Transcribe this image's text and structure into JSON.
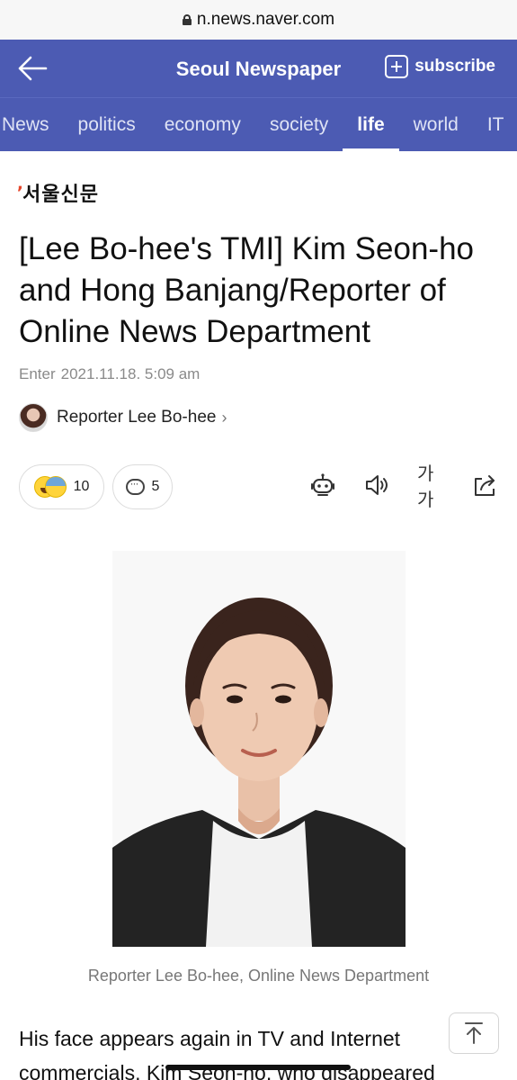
{
  "browser": {
    "url": "n.news.naver.com"
  },
  "header": {
    "title": "Seoul Newspaper",
    "subscribe_label": "subscribe"
  },
  "tabs": [
    {
      "label": "News",
      "active": false
    },
    {
      "label": "politics",
      "active": false
    },
    {
      "label": "economy",
      "active": false
    },
    {
      "label": "society",
      "active": false
    },
    {
      "label": "life",
      "active": true
    },
    {
      "label": "world",
      "active": false
    },
    {
      "label": "IT",
      "active": false
    }
  ],
  "article": {
    "publisher_logo": "서울신문",
    "headline": "[Lee Bo-hee's TMI] Kim Seon-ho and Hong Banjang/Reporter of Online News Department",
    "date_label": "Enter",
    "date_value": "2021.11.18. 5:09 am",
    "reporter": "Reporter Lee Bo-hee",
    "reaction_count": "10",
    "comment_count": "5",
    "font_size_label": "가가",
    "photo_caption": "Reporter Lee Bo-hee, Online News Department",
    "body_prefix": "His face appears again in TV and Internet commercials. ",
    "body_underlined": "Kim Seon-ho, who disappeared"
  },
  "colors": {
    "header_bg": "#4c5bb3",
    "logo_accent": "#e5462b"
  }
}
